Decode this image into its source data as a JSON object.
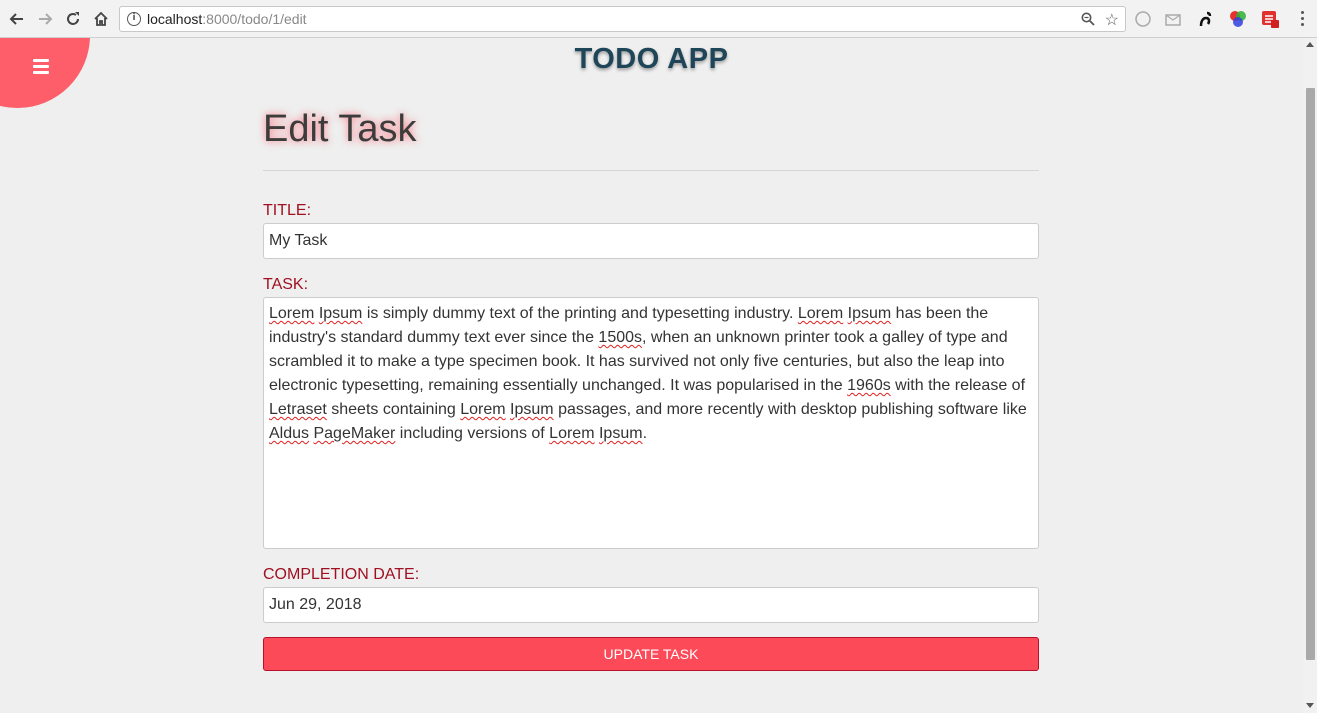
{
  "browser": {
    "url_host": "localhost",
    "url_path": ":8000/todo/1/edit"
  },
  "app": {
    "title": "TODO APP"
  },
  "form": {
    "heading": "Edit Task",
    "title_label": "TITLE:",
    "title_value": "My Task",
    "task_label": "TASK:",
    "task_text": [
      {
        "t": "Lorem",
        "s": true
      },
      {
        "t": " "
      },
      {
        "t": "Ipsum",
        "s": true
      },
      {
        "t": " is simply dummy text of the printing and typesetting industry. "
      },
      {
        "t": "Lorem",
        "s": true
      },
      {
        "t": " "
      },
      {
        "t": "Ipsum",
        "s": true
      },
      {
        "t": " has been the industry's standard dummy text ever since the "
      },
      {
        "t": "1500s",
        "s": true
      },
      {
        "t": ", when an unknown printer took a galley of type and scrambled it to make a type specimen book. It has survived not only five centuries, but also the leap into electronic typesetting, remaining essentially unchanged. It was popularised in the "
      },
      {
        "t": "1960s",
        "s": true
      },
      {
        "t": " with the release of "
      },
      {
        "t": "Letraset",
        "s": true
      },
      {
        "t": " sheets containing "
      },
      {
        "t": "Lorem",
        "s": true
      },
      {
        "t": " "
      },
      {
        "t": "Ipsum",
        "s": true
      },
      {
        "t": " passages, and more recently with desktop publishing software like "
      },
      {
        "t": "Aldus",
        "s": true
      },
      {
        "t": " "
      },
      {
        "t": "PageMaker",
        "s": true
      },
      {
        "t": " including versions of "
      },
      {
        "t": "Lorem",
        "s": true
      },
      {
        "t": " "
      },
      {
        "t": "Ipsum",
        "s": true
      },
      {
        "t": "."
      }
    ],
    "date_label": "COMPLETION DATE:",
    "date_value": "Jun 29, 2018",
    "submit_label": "UPDATE TASK"
  },
  "colors": {
    "accent": "#fd5e6a",
    "button": "#fd4a58",
    "label": "#a01020",
    "title": "#1f4558"
  },
  "icons": [
    "back-icon",
    "forward-icon",
    "reload-icon",
    "home-icon",
    "info-icon",
    "zoom-icon",
    "star-icon",
    "hamburger-icon"
  ]
}
